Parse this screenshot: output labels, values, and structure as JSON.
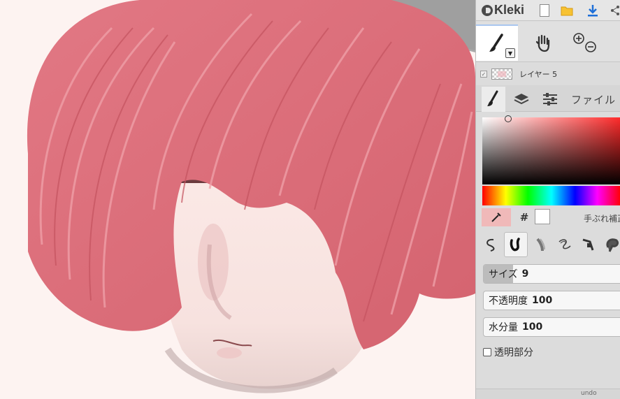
{
  "app": {
    "name": "Kleki"
  },
  "colors": {
    "accent_download": "#1e6fd8",
    "canvas_bg": "#fdf3f1",
    "hair": "#e47f89",
    "panel_bg": "#dcdcdc"
  },
  "toolbar": {
    "tools": [
      {
        "name": "brush-icon",
        "active": true
      },
      {
        "name": "hand-icon",
        "active": false
      },
      {
        "name": "zoom-icon",
        "active": false
      }
    ]
  },
  "layer": {
    "name": "レイヤー 5"
  },
  "tabs": [
    {
      "icon": "brush-icon",
      "active": true
    },
    {
      "icon": "layers-icon",
      "active": false
    },
    {
      "icon": "adjust-icon",
      "active": false
    },
    {
      "label": "ファイル",
      "active": false
    }
  ],
  "color": {
    "hash_label": "#",
    "stabilizer_label": "手ぶれ補正",
    "current_color": "#ffffff"
  },
  "brushes": [
    "lasso-brush-icon",
    "pen-brush-icon",
    "blend-brush-icon",
    "sketchy-brush-icon",
    "pixel-brush-icon",
    "smudge-brush-icon"
  ],
  "sliders": {
    "size": {
      "label": "サイズ",
      "value": "9",
      "fraction": 0.21
    },
    "opacity": {
      "label": "不透明度",
      "value": "100",
      "fraction": 1.0
    },
    "water": {
      "label": "水分量",
      "value": "100",
      "fraction": 1.0
    }
  },
  "transparent": {
    "label": "透明部分",
    "checked": false
  },
  "bottom": {
    "undo_label": "undo"
  }
}
